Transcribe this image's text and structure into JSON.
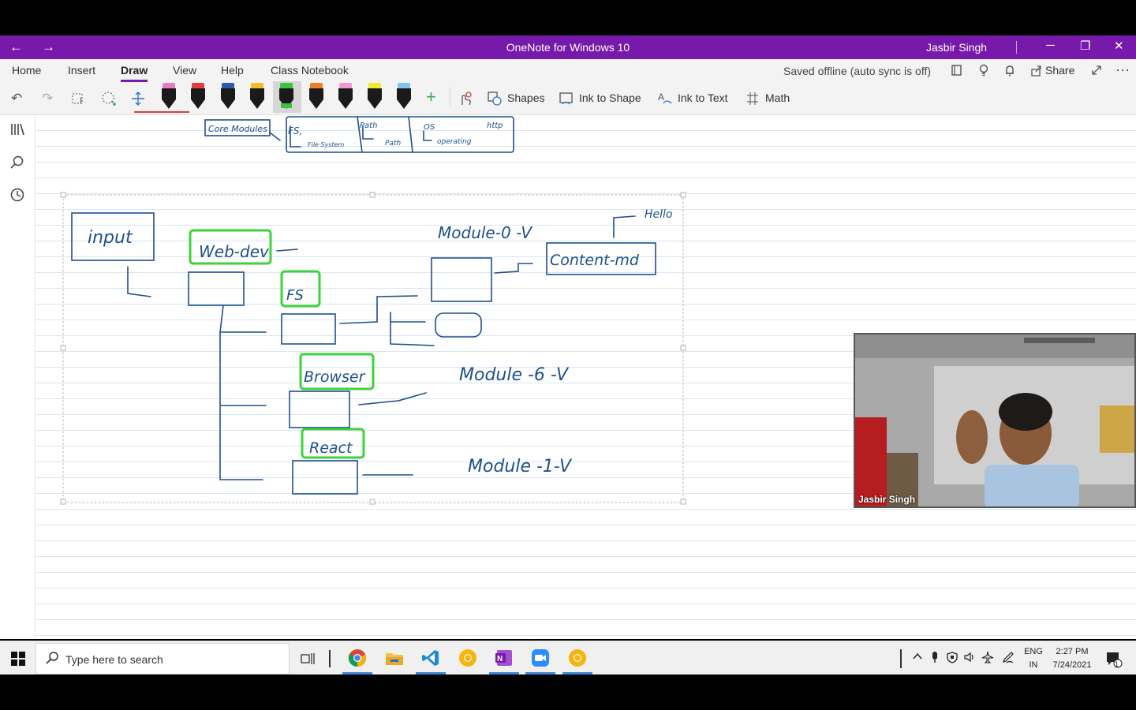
{
  "window": {
    "title": "OneNote for Windows 10",
    "user": "Jasbir Singh",
    "back_icon": "←",
    "forward_icon": "→",
    "minimize_icon": "─",
    "restore_icon": "❐",
    "close_icon": "✕"
  },
  "menu": {
    "tabs": [
      {
        "label": "Home"
      },
      {
        "label": "Insert"
      },
      {
        "label": "Draw"
      },
      {
        "label": "View"
      },
      {
        "label": "Help"
      },
      {
        "label": "Class Notebook"
      }
    ],
    "active_tab": "Draw",
    "status": "Saved offline (auto sync is off)",
    "share_label": "Share"
  },
  "draw_toolbar": {
    "shapes_label": "Shapes",
    "ink_to_shape_label": "Ink to Shape",
    "ink_to_text_label": "Ink to Text",
    "math_label": "Math",
    "pens": [
      {
        "cap_color": "#e87cc0"
      },
      {
        "cap_color": "#e23c3c"
      },
      {
        "cap_color": "#2a5aa8"
      },
      {
        "cap_color": "#f0c020"
      },
      {
        "cap_color": "#3fc23f"
      },
      {
        "cap_color": "#f07d1f"
      },
      {
        "cap_color": "#f19ad2"
      },
      {
        "cap_color": "#f3ea2d"
      },
      {
        "cap_color": "#7cc4ef"
      }
    ],
    "selected_pen_index": 4
  },
  "video": {
    "participant_name": "Jasbir Singh"
  },
  "taskbar": {
    "search_placeholder": "Type here to search",
    "language_line1": "ENG",
    "language_line2": "IN",
    "time": "2:27 PM",
    "date": "7/24/2021",
    "notification_count": "1"
  },
  "handwriting": {
    "core_modules": "Core Modules",
    "fs": "FS,",
    "file_system": "File System",
    "path": "Path",
    "path_sub": "Path",
    "os": "OS",
    "os_sub": "operating",
    "http": "http",
    "input": "input",
    "web_dev": "Web-dev",
    "module_0": "Module-0 -V",
    "hello": "Hello",
    "content_md": "Content-md",
    "fs2": "FS",
    "browser": "Browser",
    "module_6": "Module -6 -V",
    "react": "React",
    "module_1": "Module -1-V"
  },
  "colors": {
    "accent": "#7719aa",
    "ink": "#1d4f91",
    "highlight": "#3fd23a"
  }
}
